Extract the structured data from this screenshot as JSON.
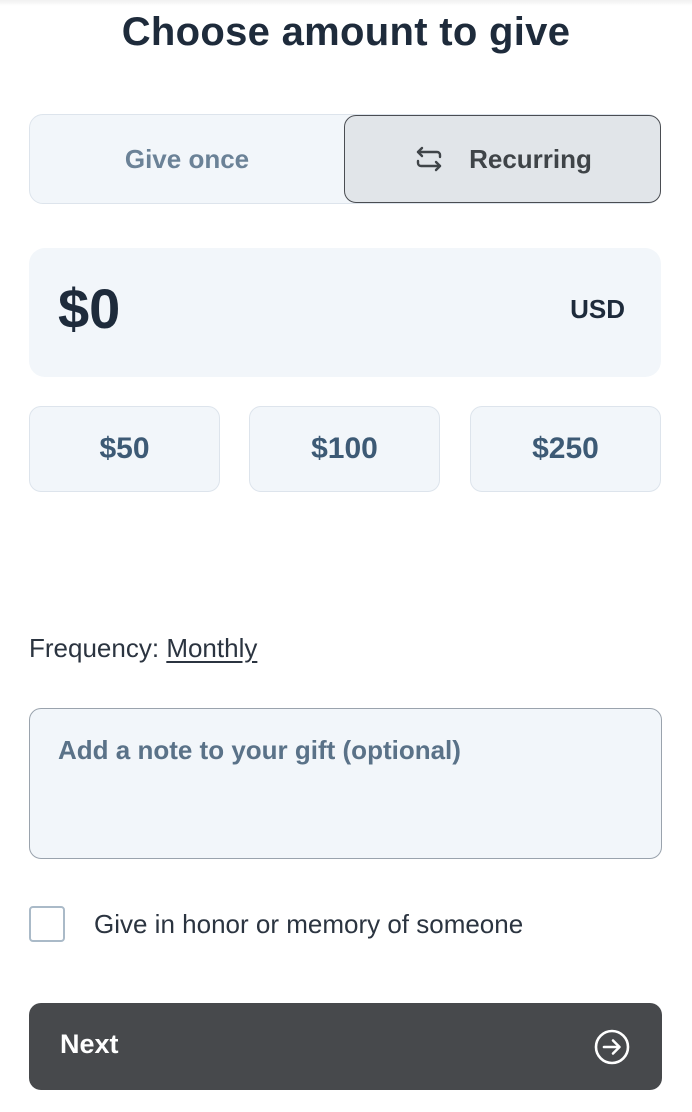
{
  "header": {
    "title": "Choose amount to give"
  },
  "frequency_toggle": {
    "once_label": "Give once",
    "recurring_label": "Recurring",
    "recurring_icon": "repeat-icon",
    "selected": "Recurring"
  },
  "amount": {
    "value": "$0",
    "currency": "USD"
  },
  "presets": [
    "$50",
    "$100",
    "$250"
  ],
  "frequency": {
    "label": "Frequency:",
    "value": "Monthly"
  },
  "note": {
    "placeholder": "Add a note to your gift (optional)"
  },
  "honor": {
    "label": "Give in honor or memory of someone",
    "checked": false
  },
  "next_button": {
    "label": "Next",
    "icon": "arrow-right-circle-icon"
  },
  "colors": {
    "primary_button": "#47494c",
    "panel_background": "#f2f6fa",
    "heading": "#1e2b3b"
  }
}
